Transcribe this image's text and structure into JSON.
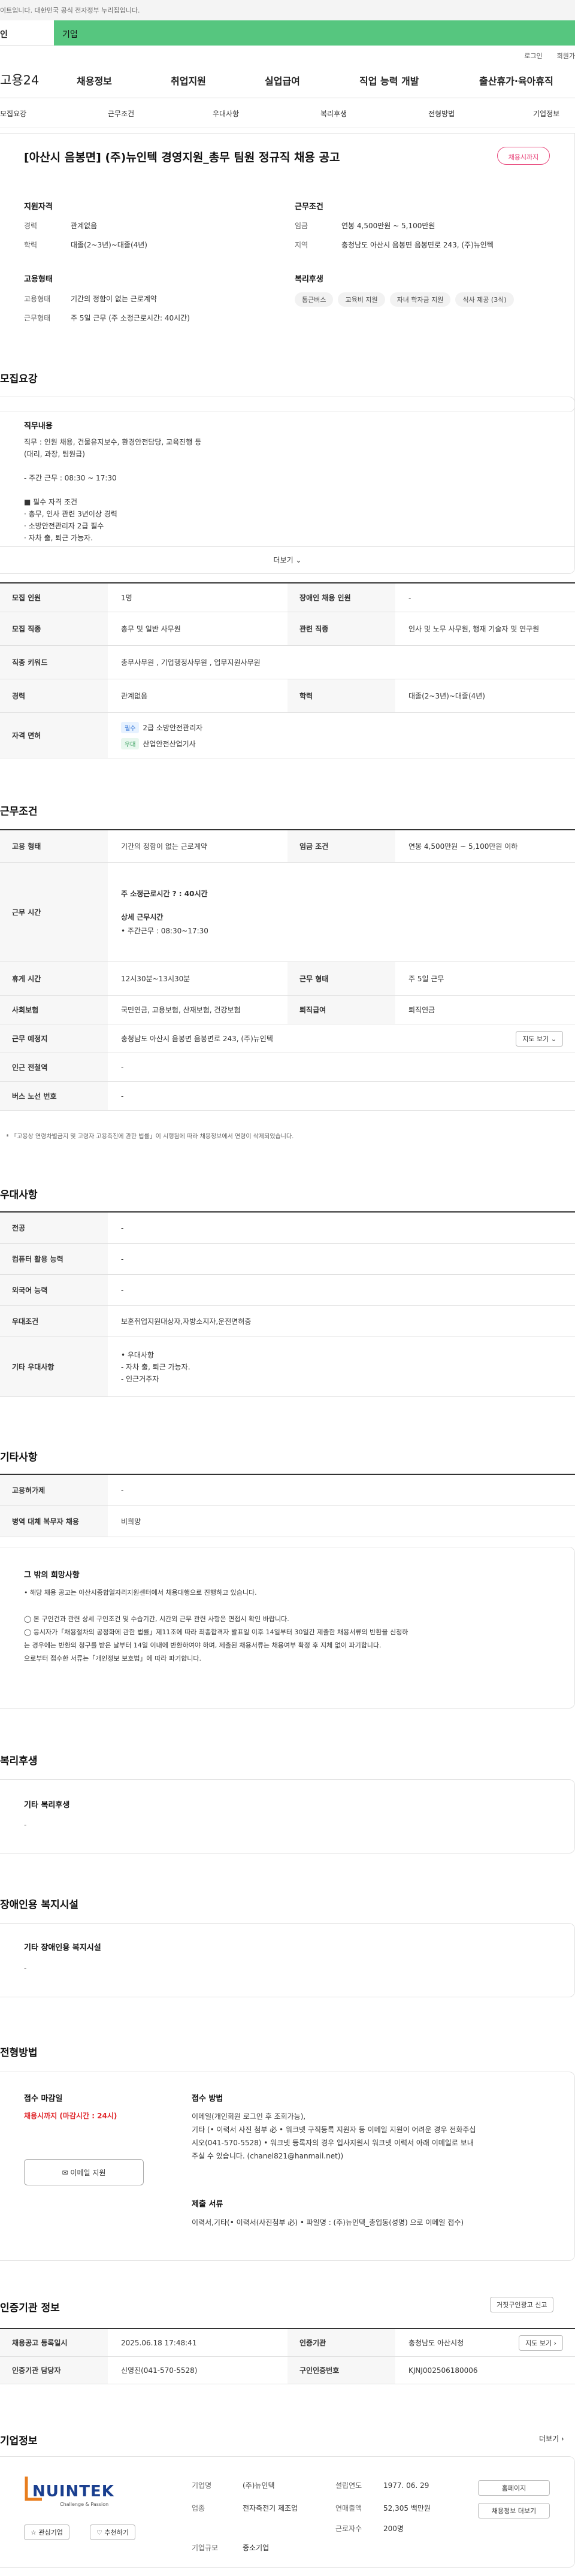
{
  "top": {
    "notice": "이트입니다. 대한민국 공식 전자정부 누리집입니다.",
    "tab_left": "인",
    "tab_right": "기업",
    "util_login": "로그인",
    "util_member": "회원가"
  },
  "gnb": {
    "logo": "고용24",
    "menus": [
      "채용정보",
      "취업지원",
      "실업급여",
      "직업 능력 개발",
      "출산휴가·육아휴직"
    ]
  },
  "snb": [
    "모집요강",
    "근무조건",
    "우대사항",
    "복리후생",
    "전형방법",
    "기업정보"
  ],
  "job": {
    "title": "[아산시 음봉면] (주)뉴인텍 경영지원_총무 팀원 정규직 채용 공고",
    "scrap": "채용시까지"
  },
  "summary": {
    "qual_h": "지원자격",
    "career_k": "경력",
    "career_v": "관계없음",
    "edu_k": "학력",
    "edu_v": "대졸(2~3년)~대졸(4년)",
    "emp_h": "고용형태",
    "emptype_k": "고용형태",
    "emptype_v": "기간의 정함이 없는 근로계약",
    "worktype_k": "근무형태",
    "worktype_v": "주 5일 근무 (주 소정근로시간: 40시간)",
    "cond_h": "근무조건",
    "wage_k": "임금",
    "wage_v": "연봉 4,500만원 ~ 5,100만원",
    "area_k": "지역",
    "area_v": "충청남도 아산시 음봉면 음봉면로 243, (주)뉴인텍",
    "welfare_h": "복리후생",
    "welfare_chips": [
      "통근버스",
      "교육비 지원",
      "자녀 학자금 지원",
      "식사 제공 (3식)"
    ]
  },
  "recruit": {
    "heading": "모집요강",
    "duty_h": "직무내용",
    "duty_text": "직무 : 인원 채용, 건물유지보수, 환경안전담당, 교육진행 등\n     (대리, 과장, 팀원급)\n\n- 주간 근무 : 08:30 ~ 17:30\n\n■ 필수 자격 조건\n · 총무, 인사 관련 3년이상 경력\n · 소방안전관리자 2급 필수\n · 자차 출, 퇴근 가능자.",
    "more": "더보기 ⌄",
    "rows": {
      "count_k": "모집 인원",
      "count_v": "1명",
      "disabled_k": "장애인 채용 인원",
      "disabled_v": "-",
      "job_k": "모집 직종",
      "job_v": "총무 및 일반 사무원",
      "related_k": "관련 직종",
      "related_v": "인사 및 노무 사무원, 행재 기술자 및 연구원",
      "kw_k": "직종 키워드",
      "kw_v": "총무사무원 , 기업행정사무원 , 업무지원사무원",
      "career_k": "경력",
      "career_v": "관계없음",
      "edu_k": "학력",
      "edu_v": "대졸(2~3년)~대졸(4년)",
      "license_k": "자격 면허",
      "lic1_badge": "필수",
      "lic1": "2급 소방안전관리자",
      "lic2_badge": "우대",
      "lic2": "산업안전산업기사"
    }
  },
  "work": {
    "heading": "근무조건",
    "emp_k": "고용 형태",
    "emp_v": "기간의 정함이 없는 근로계약",
    "wage_k": "임금 조건",
    "wage_v": "연봉 4,500만원 ~ 5,100만원 이하",
    "time_k": "근무 시간",
    "time_v1": "주 소정근로시간 ? : 40시간",
    "time_v2": "상세 근무시간",
    "time_v3": "• 주간근무 : 08:30~17:30",
    "rest_k": "휴게 시간",
    "rest_v": "12시30분~13시30분",
    "type_k": "근무 형태",
    "type_v": "주 5일 근무",
    "ins_k": "사회보험",
    "ins_v": "국민연금, 고용보험, 산재보험, 건강보험",
    "ret_k": "퇴직급여",
    "ret_v": "퇴직연금",
    "place_k": "근무 예정지",
    "place_v": "충청남도 아산시 음봉면 음봉면로 243, (주)뉴인텍",
    "map_btn": "지도 보기 ⌄",
    "subway_k": "인근 전철역",
    "subway_v": "-",
    "bus_k": "버스 노선 번호",
    "bus_v": "-",
    "footnote": "* 「고용상 연령차별금지 및 고령자 고용촉진에 관한 법률」이 시행됨에 따라 채용정보에서 연령이 삭제되었습니다."
  },
  "pref": {
    "heading": "우대사항",
    "major_k": "전공",
    "major_v": "-",
    "pc_k": "컴퓨터 활용 능력",
    "pc_v": "-",
    "lang_k": "외국어 능력",
    "lang_v": "-",
    "cond_k": "우대조건",
    "cond_v": "보훈취업지원대상자,자방소지자,운전면허증",
    "etc_k": "기타 우대사항",
    "etc_v": "• 우대사항\n  - 자차 출, 퇴근 가능자.\n  - 인근거주자"
  },
  "other": {
    "heading": "기타사항",
    "device_k": "고용허가제",
    "device_v": "-",
    "mil_k": "병역 대체 복무자 채용",
    "mil_v": "비희망",
    "info_h": "그 밖의 희망사항",
    "info_text": "• 해당 채용 공고는 아산시종합일자리지원센터에서 채용대행으로 진행하고 있습니다.\n\n◯ 본 구인건과 관련 상세 구인조건 및 수습기간, 시간외 근무 관련 사항은 면접시 확인 바랍니다.\n◯ 응시자가「채용절차의 공정화에 관한 법률」제11조에 따라 최종합격자 발표일 이후 14일부터 30일간 제출한 채용서류의 반환을 신청하\n   는 경우에는 반환의 청구를 받은 날부터 14일 이내에 반환하여야 하며, 제출된 채용서류는 채용여부 확정 후 지체 없이 파기합니다.\n   으로부터 접수한 서류는「개인정보 보호법」에 따라 파기합니다."
  },
  "welfare": {
    "heading": "복리후생",
    "etc_h": "기타 복리후생",
    "etc_v": "-"
  },
  "disabled": {
    "heading": "장애인용 복지시설",
    "etc_h": "기타 장애인용 복지시설",
    "etc_v": "-"
  },
  "apply": {
    "heading": "전형방법",
    "deadline_h": "접수 마감일",
    "deadline_v": "채용시까지 (마감시간 : 24시)",
    "email_btn": "✉ 이메일 지원",
    "method_h": "접수 방법",
    "method_v": "이메일(개인회원 로그인 후 조회가능),\n기타 (• 이력서 사진 첨부 必 • 워크넷 구직등록 지원자 등 이메일 지원이 어려운 경우 전화주십\n시오(041-570-5528) • 워크넷 등록자의 경우 입사지원시 워크넷 이력서 아래 이메일로 보내\n주실 수 있습니다.  (chanel821@hanmail.net))",
    "docs_h": "제출 서류",
    "docs_v": "이력서,기타(• 이력서(사진첨부 必) • 파일명 : (주)뉴인텍_총입동(성명) 으로 이메일 접수)"
  },
  "agency": {
    "heading": "인증기관 정보",
    "btn": "거짓구인광고 신고",
    "reg_k": "채용공고 등록일시",
    "reg_v": "2025.06.18 17:48:41",
    "org_k": "인증기관",
    "org_v": "충청남도 아산시청",
    "map_btn": "지도 보기 ›",
    "mgr_k": "인증기관 담당자",
    "mgr_v": "신영진(041-570-5528)",
    "num_k": "구인인증번호",
    "num_v": "KJNJ002506180006"
  },
  "company": {
    "heading": "기업정보",
    "more": "더보기 ›",
    "logo_text": "NUINTEK",
    "logo_sub": "Challenge & Passion",
    "fav_btn": "☆ 관심기업",
    "rec_btn": "♡ 추천하기",
    "name_k": "기업명",
    "name_v": "(주)뉴인텍",
    "ind_k": "업종",
    "ind_v": "전자축전기 제조업",
    "size_k": "기업규모",
    "size_v": "중소기업",
    "est_k": "설립연도",
    "est_v": "1977. 06. 29",
    "sales_k": "연매출액",
    "sales_v": "52,305 백만원",
    "emp_k": "근로자수",
    "emp_v": "200명",
    "home_btn": "홈페이지",
    "jobs_btn": "채용정보 더보기"
  }
}
